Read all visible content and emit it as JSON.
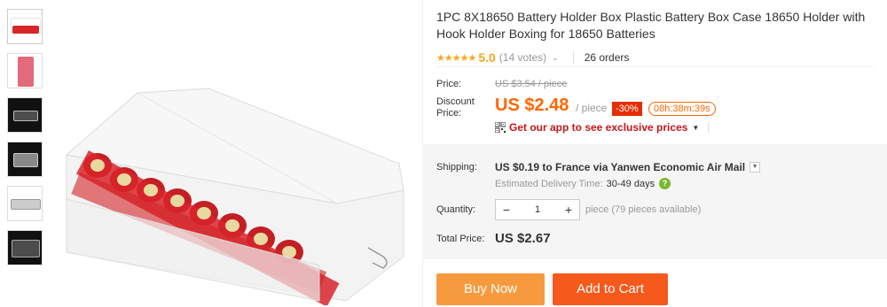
{
  "thumbnails": [
    {
      "alt": "battery-box-open-icon",
      "dark": false
    },
    {
      "alt": "battery-box-stack-icon",
      "dark": false
    },
    {
      "alt": "battery-box-empty-icon",
      "dark": true
    },
    {
      "alt": "battery-box-closed-icon",
      "dark": true
    },
    {
      "alt": "battery-box-side-icon",
      "dark": false
    },
    {
      "alt": "battery-box-top-icon",
      "dark": true
    }
  ],
  "product": {
    "title": "1PC 8X18650 Battery Holder Box Plastic Battery Box Case 18650 Holder with Hook Holder Boxing for 18650 Batteries",
    "stars": "★★★★★",
    "rating": "5.0",
    "votes": "(14 votes)",
    "orders": "26 orders"
  },
  "price": {
    "price_label": "Price:",
    "old_price": "US $3.54 / piece",
    "discount_label": "Discount Price:",
    "new_price": "US $2.48",
    "per_unit": "/ piece",
    "discount_pct": "-30%",
    "countdown": "08h:38m:39s",
    "app_promo": "Get our app to see exclusive prices"
  },
  "shipping": {
    "label": "Shipping:",
    "cost": "US $0.19",
    "destination": "to France via Yanwen Economic Air Mail",
    "est_label": "Estimated Delivery Time:",
    "est_days": "30-49 days"
  },
  "quantity": {
    "label": "Quantity:",
    "value": "1",
    "note": "piece (79 pieces available)",
    "minus": "−",
    "plus": "+"
  },
  "total": {
    "label": "Total Price:",
    "value": "US $2.67"
  },
  "actions": {
    "buy_now": "Buy Now",
    "add_to_cart": "Add to Cart"
  },
  "colors": {
    "accent": "#ff6600",
    "buy_now": "#f79a3e",
    "add_to_cart": "#f55a1c",
    "star": "#f7a61c"
  }
}
